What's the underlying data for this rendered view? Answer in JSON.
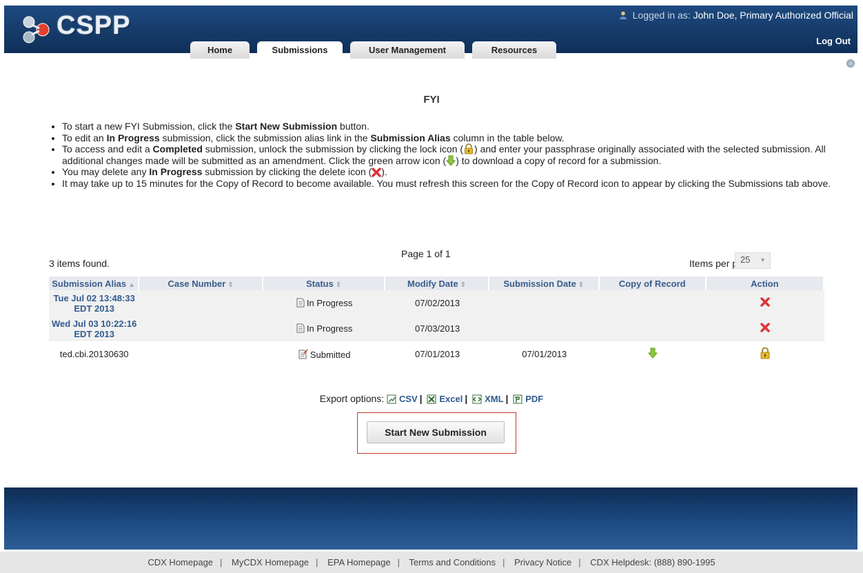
{
  "header": {
    "logo_text": "CSPP",
    "login_prefix": "Logged in as:",
    "login_user": "John Doe, Primary Authorized Official",
    "logout": "Log Out"
  },
  "tabs": [
    {
      "label": "Home"
    },
    {
      "label": "Submissions",
      "active": true
    },
    {
      "label": "User Management"
    },
    {
      "label": "Resources"
    }
  ],
  "page_title": "FYI",
  "instructions": {
    "i1_a": "To start a new FYI Submission, click the ",
    "i1_b": "Start New Submission",
    "i1_c": " button.",
    "i2_a": "To edit an ",
    "i2_b": "In Progress",
    "i2_c": " submission, click the submission alias link in the ",
    "i2_d": "Submission Alias",
    "i2_e": " column in the table below.",
    "i3_a": "To access and edit a ",
    "i3_b": "Completed",
    "i3_c": " submission, unlock the submission by clicking the lock icon (",
    "i3_d": ") and enter your passphrase originally associated with the selected submission. All additional changes made will be submitted as an amendment. Click the green arrow icon (",
    "i3_e": ") to download a copy of record for a submission.",
    "i4_a": "You may delete any ",
    "i4_b": "In Progress",
    "i4_c": " submission by clicking the delete icon (",
    "i4_d": ").",
    "i5": "It may take up to 15 minutes for the Copy of Record to become available. You must refresh this screen for the Copy of Record icon to appear by clicking the Submissions tab above."
  },
  "pagination": {
    "page_info": "Page 1 of 1",
    "items_found": "3 items found.",
    "items_per_page_label": "Items per page:",
    "items_per_page_value": "25"
  },
  "table": {
    "columns": [
      "Submission Alias",
      "Case Number",
      "Status",
      "Modify Date",
      "Submission Date",
      "Copy of Record",
      "Action"
    ],
    "rows": [
      {
        "alias_line1": "Tue Jul 02 13:48:33",
        "alias_line2": "EDT 2013",
        "case": "",
        "status": "In Progress",
        "modify": "07/02/2013",
        "submitted": "",
        "copy": "",
        "action": "delete-icon"
      },
      {
        "alias_line1": "Wed Jul 03 10:22:16",
        "alias_line2": "EDT 2013",
        "case": "",
        "status": "In Progress",
        "modify": "07/03/2013",
        "submitted": "",
        "copy": "",
        "action": "delete-icon"
      },
      {
        "alias_line1": "ted.cbi.20130630",
        "alias_line2": "",
        "case": "",
        "status": "Submitted",
        "modify": "07/01/2013",
        "submitted": "07/01/2013",
        "copy": "download-arrow-icon",
        "action": "lock-icon"
      }
    ]
  },
  "export": {
    "label": "Export options:",
    "csv": "CSV",
    "excel": "Excel",
    "xml": "XML",
    "pdf": "PDF"
  },
  "start_button": "Start New Submission",
  "footer": {
    "links": [
      "CDX Homepage",
      "MyCDX Homepage",
      "EPA Homepage",
      "Terms and Conditions",
      "Privacy Notice",
      "CDX Helpdesk: (888) 890-1995"
    ]
  },
  "colors": {
    "header_blue": "#153a68",
    "link_blue": "#2f5b8f",
    "delete_red": "#e0303a",
    "download_green": "#7cbf1e",
    "lock_gold": "#d6a520",
    "highlight_red": "#c0392b"
  }
}
